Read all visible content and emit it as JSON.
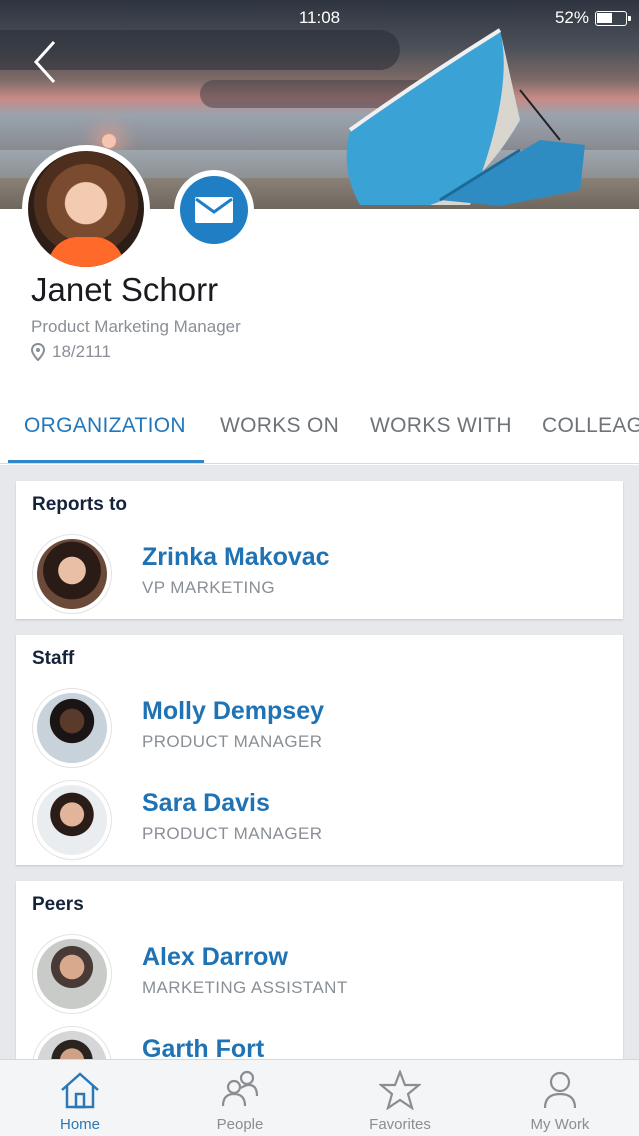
{
  "status_bar": {
    "time": "11:08",
    "battery": "52%"
  },
  "profile": {
    "name": "Janet Schorr",
    "title": "Product Marketing Manager",
    "location": "18/2111"
  },
  "tabs": [
    {
      "label": "ORGANIZATION",
      "active": true
    },
    {
      "label": "WORKS ON",
      "active": false
    },
    {
      "label": "WORKS WITH",
      "active": false
    },
    {
      "label": "COLLEAG",
      "active": false
    }
  ],
  "sections": {
    "reports_to": {
      "title": "Reports to",
      "people": [
        {
          "name": "Zrinka Makovac",
          "role": "VP MARKETING"
        }
      ]
    },
    "staff": {
      "title": "Staff",
      "people": [
        {
          "name": "Molly Dempsey",
          "role": "PRODUCT MANAGER"
        },
        {
          "name": "Sara Davis",
          "role": "PRODUCT MANAGER"
        }
      ]
    },
    "peers": {
      "title": "Peers",
      "people": [
        {
          "name": "Alex Darrow",
          "role": "MARKETING ASSISTANT"
        },
        {
          "name": "Garth Fort",
          "role": ""
        }
      ]
    }
  },
  "bottom_nav": [
    {
      "label": "Home",
      "icon": "home-icon",
      "active": true
    },
    {
      "label": "People",
      "icon": "people-icon",
      "active": false
    },
    {
      "label": "Favorites",
      "icon": "star-icon",
      "active": false
    },
    {
      "label": "My Work",
      "icon": "person-icon",
      "active": false
    }
  ],
  "colors": {
    "accent": "#1f7ec4",
    "name_link": "#1f73b4",
    "tab_active": "#2277bb"
  }
}
